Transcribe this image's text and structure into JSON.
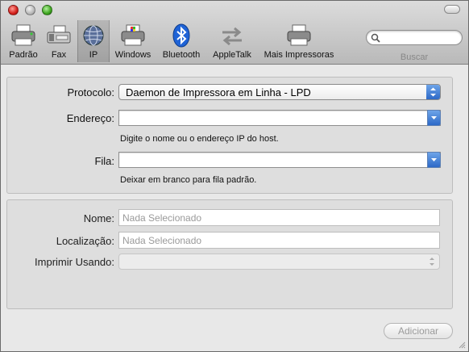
{
  "toolbar": {
    "items": [
      {
        "label": "Padrão",
        "icon": "printer-default-icon"
      },
      {
        "label": "Fax",
        "icon": "fax-icon"
      },
      {
        "label": "IP",
        "icon": "ip-globe-icon",
        "selected": true
      },
      {
        "label": "Windows",
        "icon": "windows-printer-icon"
      },
      {
        "label": "Bluetooth",
        "icon": "bluetooth-icon"
      },
      {
        "label": "AppleTalk",
        "icon": "appletalk-arrows-icon"
      },
      {
        "label": "Mais Impressoras",
        "icon": "more-printers-icon"
      }
    ],
    "search": {
      "label": "Buscar",
      "placeholder": ""
    }
  },
  "connection": {
    "protocol": {
      "label": "Protocolo:",
      "value": "Daemon de Impressora em Linha - LPD"
    },
    "address": {
      "label": "Endereço:",
      "value": "",
      "hint": "Digite o nome ou o endereço IP do host."
    },
    "queue": {
      "label": "Fila:",
      "value": "",
      "hint": "Deixar em branco para fila padrão."
    }
  },
  "details": {
    "name": {
      "label": "Nome:",
      "placeholder": "Nada Selecionado"
    },
    "location": {
      "label": "Localização:",
      "placeholder": "Nada Selecionado"
    },
    "print_using": {
      "label": "Imprimir Usando:",
      "value": ""
    }
  },
  "footer": {
    "add_label": "Adicionar"
  },
  "colors": {
    "accent": "#2d69c7",
    "window_bg": "#e8e8e8"
  }
}
